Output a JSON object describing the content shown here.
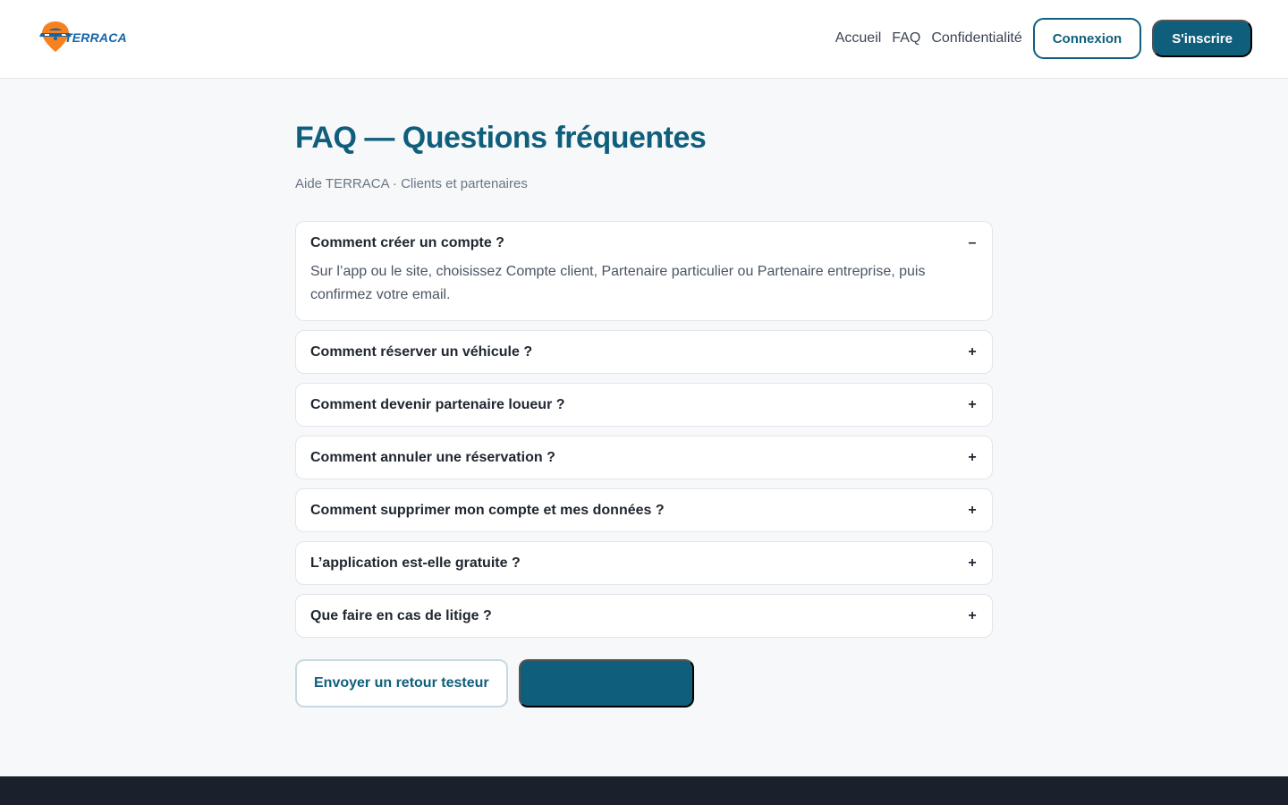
{
  "brand": {
    "name": "TERRACA",
    "logo_icon": "map-pin-car-icon"
  },
  "nav": {
    "links": [
      "Accueil",
      "FAQ",
      "Confidentialité"
    ],
    "login_label": "Connexion",
    "signup_label": "S'inscrire"
  },
  "page": {
    "title": "FAQ — Questions fréquentes",
    "subtitle": "Aide TERRACA · Clients et partenaires"
  },
  "faq": [
    {
      "question": "Comment créer un compte ?",
      "toggle": "–",
      "answer": "Sur l’app ou le site, choisissez Compte client, Partenaire particulier ou Partenaire entreprise, puis confirmez votre email."
    },
    {
      "question": "Comment réserver un véhicule ?",
      "toggle": "+"
    },
    {
      "question": "Comment devenir partenaire loueur ?",
      "toggle": "+"
    },
    {
      "question": "Comment annuler une réservation ?",
      "toggle": "+"
    },
    {
      "question": "Comment supprimer mon compte et mes données ?",
      "toggle": "+"
    },
    {
      "question": "L’application est-elle gratuite ?",
      "toggle": "+"
    },
    {
      "question": "Que faire en cas de litige ?",
      "toggle": "+"
    }
  ],
  "actions": {
    "feedback_label": "Envoyer un retour testeur",
    "secondary_label": ""
  },
  "colors": {
    "primary": "#0f5f7c",
    "accent_orange": "#f5821f",
    "footer": "#1a202c"
  }
}
